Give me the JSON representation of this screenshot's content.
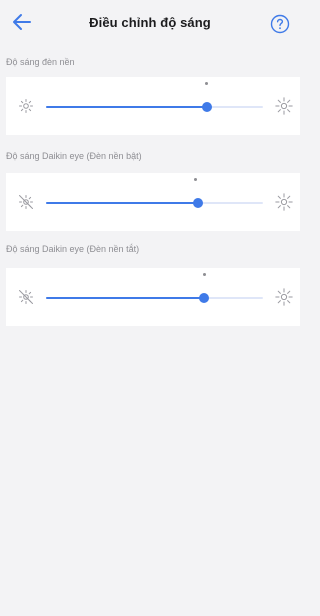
{
  "header": {
    "title": "Điều chỉnh độ sáng",
    "back_icon": "arrow-left-icon",
    "help_icon": "help-circle-icon",
    "accent_color": "#3f7ae8"
  },
  "sections": [
    {
      "label": "Độ sáng đèn nền",
      "value": 0.74
    },
    {
      "label": "Độ sáng Daikin eye (Đèn nền bật)",
      "value": 0.7
    },
    {
      "label": "Độ sáng Daikin eye (Đèn nền tắt)",
      "value": 0.73
    }
  ]
}
